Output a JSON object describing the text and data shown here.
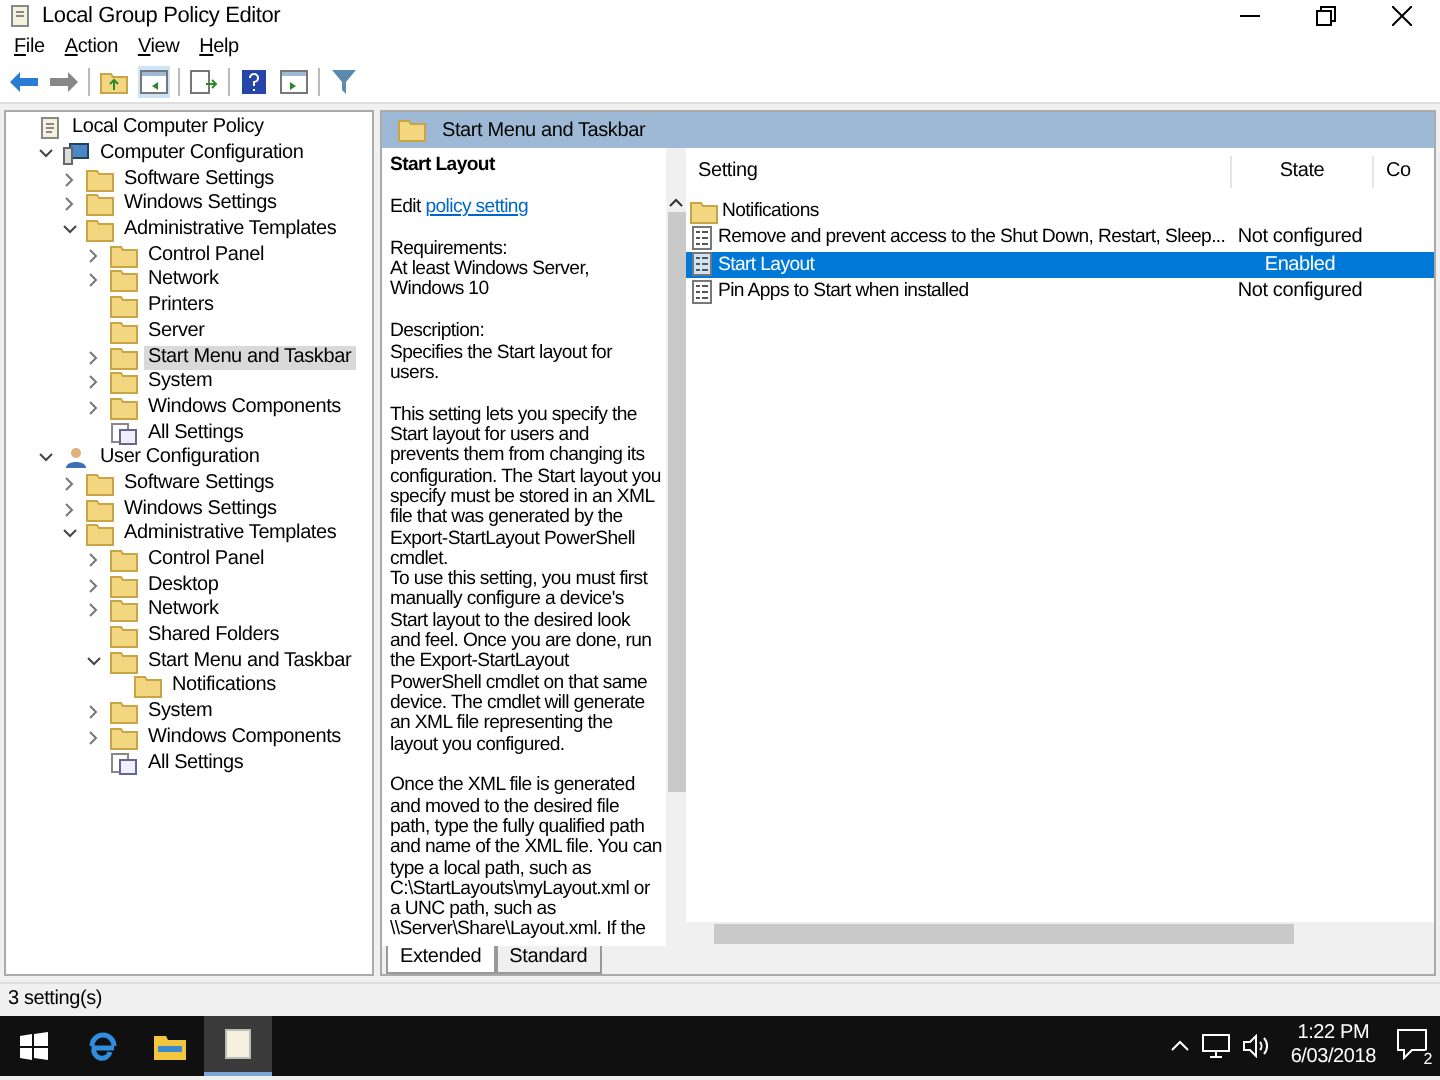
{
  "window": {
    "title": "Local Group Policy Editor"
  },
  "menu": [
    "File",
    "Action",
    "View",
    "Help"
  ],
  "tree": [
    {
      "label": "Local Computer Policy",
      "kind": "root",
      "selected": false,
      "children": [
        {
          "label": "Computer Configuration",
          "kind": "computer",
          "expanded": true,
          "selected": false,
          "children": [
            {
              "label": "Software Settings",
              "kind": "folder",
              "expanded": false,
              "selected": false
            },
            {
              "label": "Windows Settings",
              "kind": "folder",
              "expanded": false,
              "selected": false
            },
            {
              "label": "Administrative Templates",
              "kind": "folder",
              "expanded": true,
              "selected": false,
              "children": [
                {
                  "label": "Control Panel",
                  "kind": "folder",
                  "expanded": false,
                  "selected": false
                },
                {
                  "label": "Network",
                  "kind": "folder",
                  "expanded": false,
                  "selected": false
                },
                {
                  "label": "Printers",
                  "kind": "folder",
                  "selected": false
                },
                {
                  "label": "Server",
                  "kind": "folder",
                  "selected": false
                },
                {
                  "label": "Start Menu and Taskbar",
                  "kind": "folder",
                  "expanded": false,
                  "selected": true
                },
                {
                  "label": "System",
                  "kind": "folder",
                  "expanded": false,
                  "selected": false
                },
                {
                  "label": "Windows Components",
                  "kind": "folder",
                  "expanded": false,
                  "selected": false
                },
                {
                  "label": "All Settings",
                  "kind": "all",
                  "selected": false
                }
              ]
            }
          ]
        },
        {
          "label": "User Configuration",
          "kind": "user",
          "expanded": true,
          "selected": false,
          "children": [
            {
              "label": "Software Settings",
              "kind": "folder",
              "expanded": false,
              "selected": false
            },
            {
              "label": "Windows Settings",
              "kind": "folder",
              "expanded": false,
              "selected": false
            },
            {
              "label": "Administrative Templates",
              "kind": "folder",
              "expanded": true,
              "selected": false,
              "children": [
                {
                  "label": "Control Panel",
                  "kind": "folder",
                  "expanded": false,
                  "selected": false
                },
                {
                  "label": "Desktop",
                  "kind": "folder",
                  "expanded": false,
                  "selected": false
                },
                {
                  "label": "Network",
                  "kind": "folder",
                  "expanded": false,
                  "selected": false
                },
                {
                  "label": "Shared Folders",
                  "kind": "folder",
                  "selected": false
                },
                {
                  "label": "Start Menu and Taskbar",
                  "kind": "folder",
                  "expanded": true,
                  "selected": false,
                  "children": [
                    {
                      "label": "Notifications",
                      "kind": "folder",
                      "selected": false
                    }
                  ]
                },
                {
                  "label": "System",
                  "kind": "folder",
                  "expanded": false,
                  "selected": false
                },
                {
                  "label": "Windows Components",
                  "kind": "folder",
                  "expanded": false,
                  "selected": false
                },
                {
                  "label": "All Settings",
                  "kind": "all",
                  "selected": false
                }
              ]
            }
          ]
        }
      ]
    }
  ],
  "details": {
    "header": "Start Menu and Taskbar",
    "title": "Start Layout",
    "edit_prefix": "Edit",
    "edit_link": "policy setting",
    "requirements_label": "Requirements:",
    "requirements": "At least Windows Server, Windows 10",
    "description_label": "Description:",
    "description": "Specifies the Start layout for users.",
    "paragraphs": [
      "This setting lets you specify the Start layout for users and prevents them from changing its configuration. The Start layout you specify must be stored in an XML file that was generated by the Export-StartLayout PowerShell cmdlet.",
      "To use this setting, you must first manually configure a device's Start layout to the desired look and feel. Once you are done, run the Export-StartLayout PowerShell cmdlet on that same device. The cmdlet will generate an XML file representing the layout you configured.",
      "Once the XML file is generated and moved to the desired file path, type the fully qualified path and name of the XML file. You can type a local path, such as C:\\StartLayouts\\myLayout.xml or a UNC path, such as \\\\Server\\Share\\Layout.xml. If the"
    ]
  },
  "table": {
    "columns": [
      "Setting",
      "State",
      "Co"
    ],
    "rows": [
      {
        "kind": "folder",
        "setting": "Notifications",
        "selected": false
      },
      {
        "kind": "policy",
        "setting": "Remove and prevent access to the Shut Down, Restart, Sleep...",
        "state": "Not configured",
        "selected": false
      },
      {
        "kind": "policy",
        "setting": "Start Layout",
        "state": "Enabled",
        "selected": true
      },
      {
        "kind": "policy",
        "setting": "Pin Apps to Start when installed",
        "state": "Not configured",
        "selected": false
      }
    ]
  },
  "view_tabs": [
    {
      "label": "Extended",
      "selected": true
    },
    {
      "label": "Standard",
      "selected": false
    }
  ],
  "status_bar": "3 setting(s)",
  "taskbar": {
    "apps": [
      {
        "kind": "edge",
        "selected": false
      },
      {
        "kind": "explorer",
        "selected": false
      },
      {
        "kind": "gpedit",
        "selected": true
      }
    ],
    "time": "1:22 PM",
    "date": "6/03/2018",
    "notifications": "2"
  }
}
